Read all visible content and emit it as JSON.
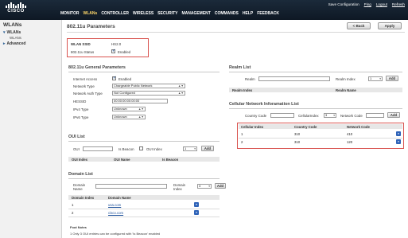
{
  "brand": {
    "name": "CISCO"
  },
  "utility": {
    "save": "Save Configuration",
    "ping": "Ping",
    "logout": "Logout",
    "refresh": "Refresh"
  },
  "nav": [
    "MONITOR",
    "WLANs",
    "CONTROLLER",
    "WIRELESS",
    "SECURITY",
    "MANAGEMENT",
    "COMMANDS",
    "HELP",
    "FEEDBACK"
  ],
  "nav_active": "WLANs",
  "sidebar": {
    "title": "WLANs",
    "item_wlans": "WLANs",
    "item_wlans_sub": "WLANs",
    "item_advanced": "Advanced"
  },
  "page": {
    "title": "802.11u Parameters",
    "back": "< Back",
    "apply": "Apply"
  },
  "wlan": {
    "ssid_label": "WLAN SSID",
    "ssid_value": "HS2.0",
    "status_label": "802.11u Status",
    "status_value": "Enabled"
  },
  "general": {
    "title": "802.11u General Parameters",
    "internet_access_label": "Internet Access",
    "internet_access_value": "Enabled",
    "network_type_label": "Network Type",
    "network_type_value": "Chargeable Public Network",
    "network_auth_label": "Network Auth Type",
    "network_auth_value": "Not Configured",
    "hessid_label": "HESSID",
    "hessid_value": "00:00:00:00:00:00",
    "ipv4_label": "IPv4 Type",
    "ipv4_value": "Unknown",
    "ipv6_label": "IPv6 Type",
    "ipv6_value": "Unknown"
  },
  "oui": {
    "title": "OUI List",
    "oui_label": "OUI",
    "is_beacon_label": "Is Beacon",
    "oui_index_label": "OUI Index",
    "oui_index_value": "1",
    "add": "Add",
    "columns": [
      "OUI Index",
      "OUI Name",
      "Is Beacon"
    ]
  },
  "domain": {
    "title": "Domain List",
    "name_label": "Domain Name",
    "index_label": "Domain Index",
    "index_value": "3",
    "add": "Add",
    "columns": [
      "Domain Index",
      "Domain Name"
    ],
    "rows": [
      {
        "index": "1",
        "name": "usa.com"
      },
      {
        "index": "2",
        "name": "cisco.com"
      }
    ]
  },
  "realm": {
    "title": "Realm List",
    "realm_label": "Realm",
    "index_label": "Realm Index",
    "index_value": "1",
    "add": "Add",
    "columns": [
      "Realm Index",
      "Realm Name"
    ]
  },
  "cellular": {
    "title": "Cellular Network Inforamation List",
    "country_label": "Country Code",
    "cellular_index_label": "CellularIndex",
    "cellular_index_value": "3",
    "network_code_label": "Network Code",
    "add": "Add",
    "columns": [
      "Cellular Index",
      "Country Code",
      "Network Code"
    ],
    "rows": [
      {
        "index": "1",
        "country": "310",
        "network": "410"
      },
      {
        "index": "2",
        "country": "310",
        "network": "120"
      }
    ]
  },
  "footnotes": {
    "title": "Foot Notes",
    "note1": "1 Only 3 OUI entries can be configured with 'Is Beacon' enabled"
  },
  "colors": {
    "highlight": "#d9534f",
    "link": "#1b4f9a",
    "nav_active": "#ffd86a",
    "topbar": "#14202d"
  },
  "icons": [
    "dropdown-arrow-icon",
    "checkmark-icon"
  ]
}
